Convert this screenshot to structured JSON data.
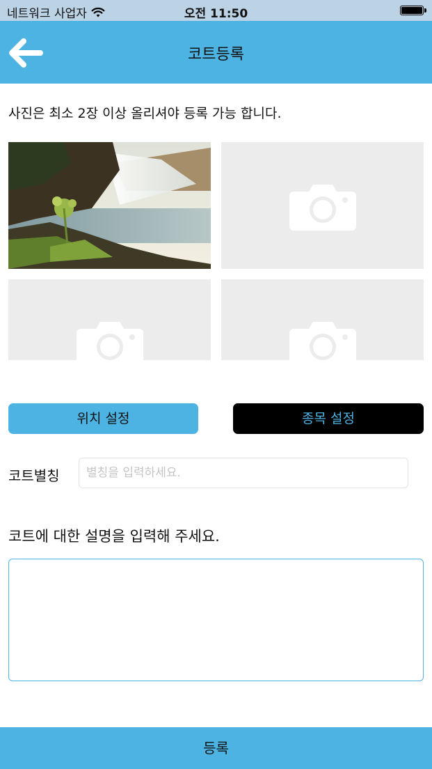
{
  "status_bar": {
    "carrier": "네트워크 사업자",
    "time": "오전 11:50"
  },
  "header": {
    "title": "코트등록",
    "back_icon": "arrow-left-icon"
  },
  "notice": "사진은 최소 2장 이상 올리셔야 등록 가능 합니다.",
  "photos": [
    {
      "state": "filled",
      "subject": "waterfall"
    },
    {
      "state": "empty",
      "icon": "camera-icon"
    },
    {
      "state": "empty",
      "icon": "camera-icon"
    },
    {
      "state": "empty",
      "icon": "camera-icon"
    }
  ],
  "buttons": {
    "location": "위치 설정",
    "category": "종목 설정"
  },
  "nickname": {
    "label": "코트별칭",
    "placeholder": "별칭을 입력하세요.",
    "value": ""
  },
  "description": {
    "label": "코트에 대한 설명을 입력해 주세요.",
    "value": ""
  },
  "submit": "등록",
  "colors": {
    "accent": "#4cb3e3",
    "status_bar": "#bcd2e5",
    "placeholder_tile": "#ececec",
    "category_button": "#000000"
  }
}
